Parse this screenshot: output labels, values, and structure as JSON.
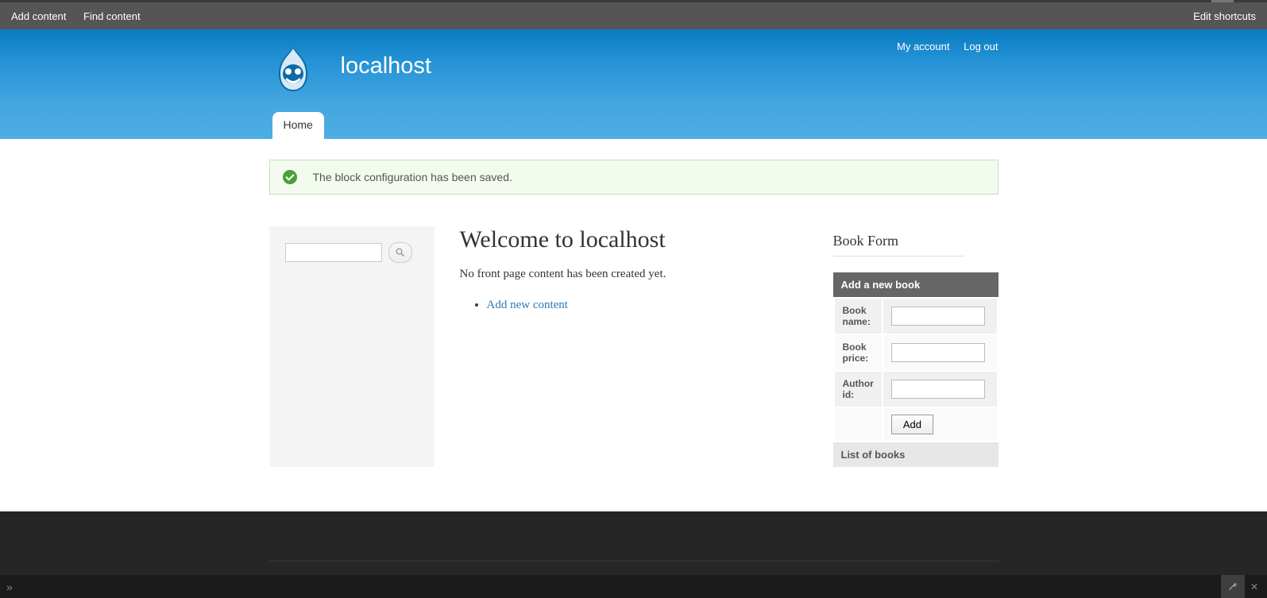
{
  "toolbar": {
    "left": [
      "Add content",
      "Find content"
    ],
    "right": "Edit shortcuts"
  },
  "header": {
    "site_name": "localhost",
    "user_links": [
      "My account",
      "Log out"
    ],
    "tabs": [
      "Home"
    ]
  },
  "status": {
    "message": "The block configuration has been saved."
  },
  "main": {
    "title": "Welcome to localhost",
    "body": "No front page content has been created yet.",
    "link": "Add new content"
  },
  "book_form": {
    "title": "Book Form",
    "header": "Add a new book",
    "fields": [
      {
        "label": "Book name:",
        "value": ""
      },
      {
        "label": "Book price:",
        "value": ""
      },
      {
        "label": "Author id:",
        "value": ""
      }
    ],
    "submit": "Add",
    "footer": "List of books"
  }
}
